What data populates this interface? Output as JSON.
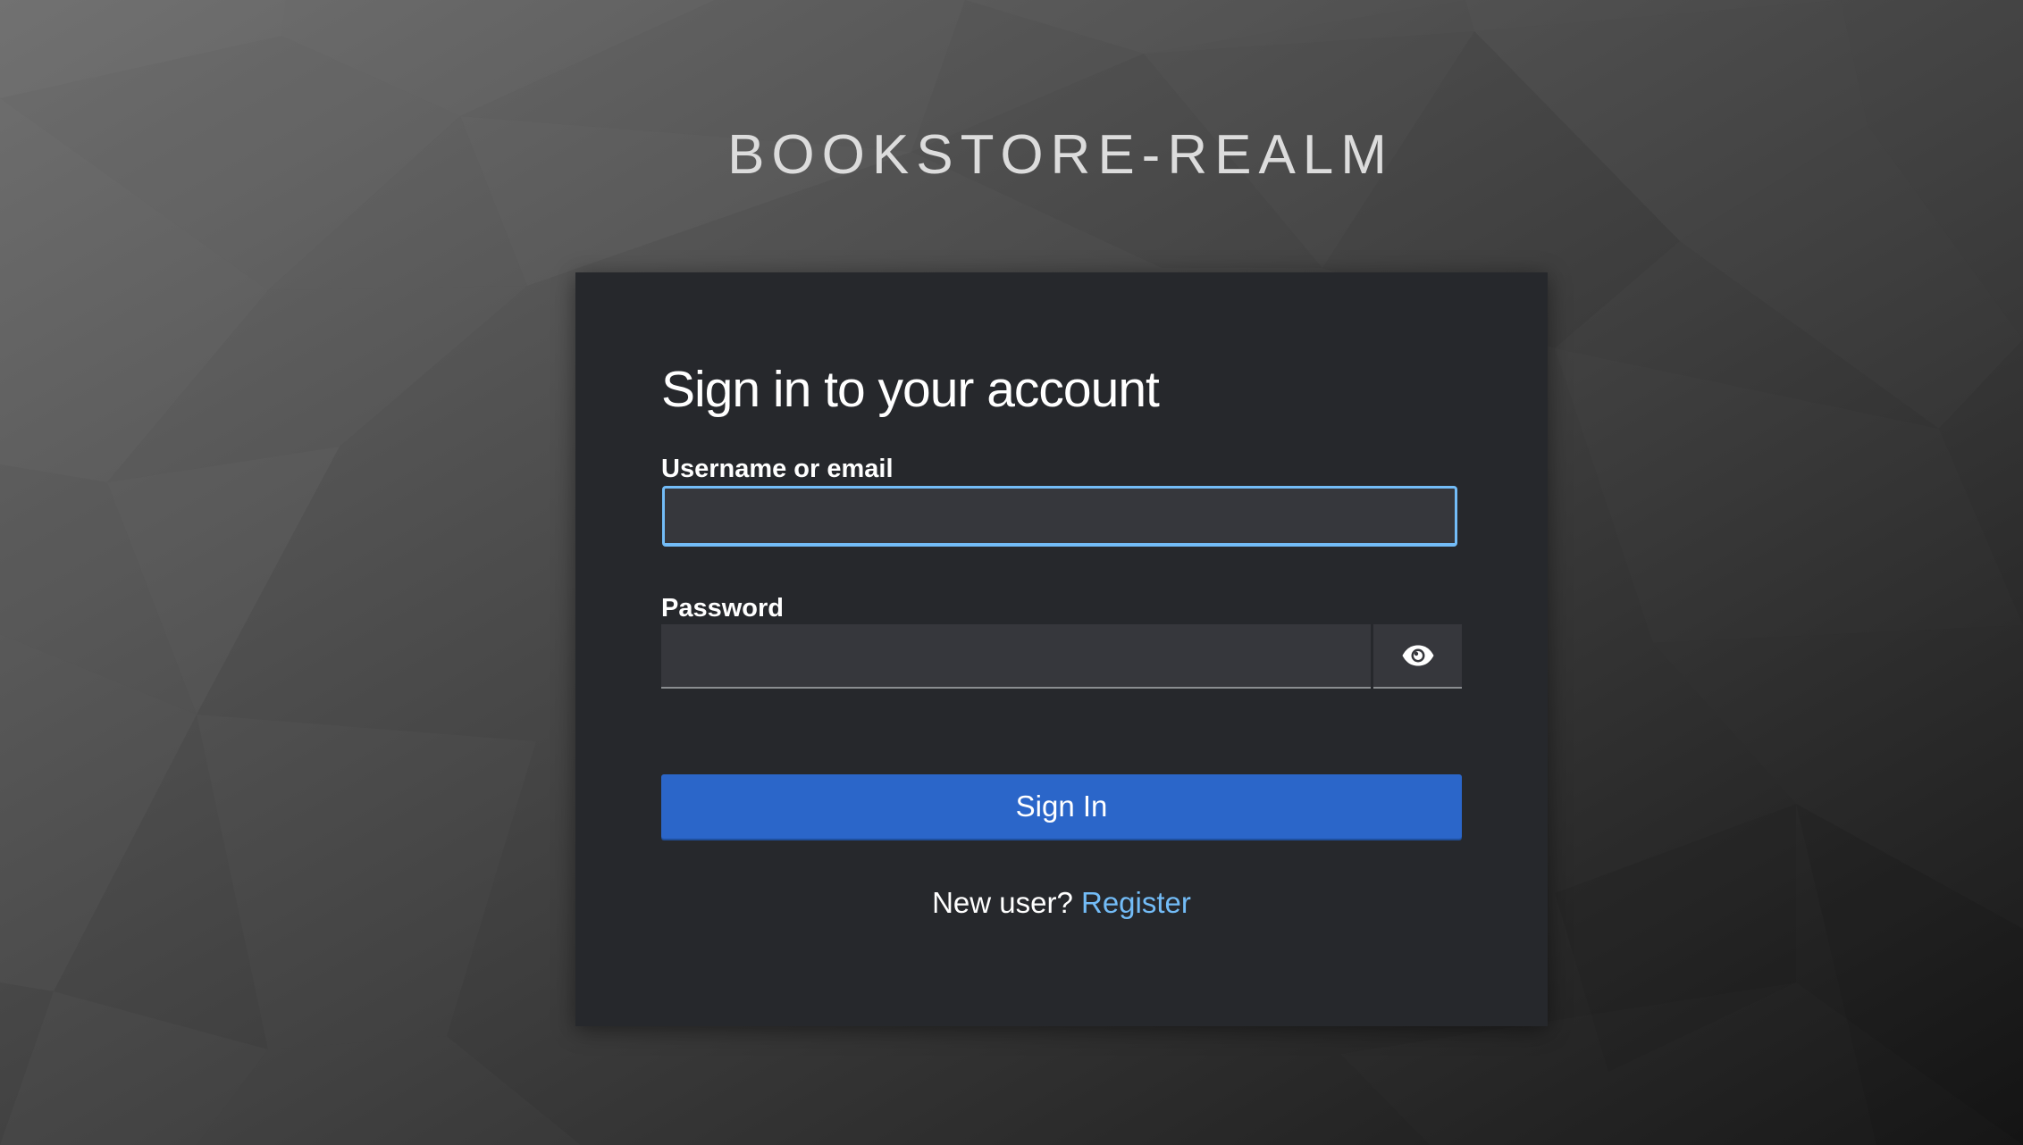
{
  "realm": {
    "title": "BOOKSTORE-REALM"
  },
  "login_form": {
    "heading": "Sign in to your account",
    "username": {
      "label": "Username or email",
      "value": "",
      "placeholder": ""
    },
    "password": {
      "label": "Password",
      "value": "",
      "placeholder": "",
      "toggle_icon": "eye-icon"
    },
    "submit_label": "Sign In",
    "register": {
      "prompt": "New user?",
      "link_label": "Register"
    }
  },
  "colors": {
    "card_background": "#26282c",
    "input_background": "#36373c",
    "focus_border": "#73bcf7",
    "primary_button": "#2b66c9",
    "link": "#73bcf7",
    "text": "#ffffff",
    "realm_title": "#dcdcdc"
  }
}
